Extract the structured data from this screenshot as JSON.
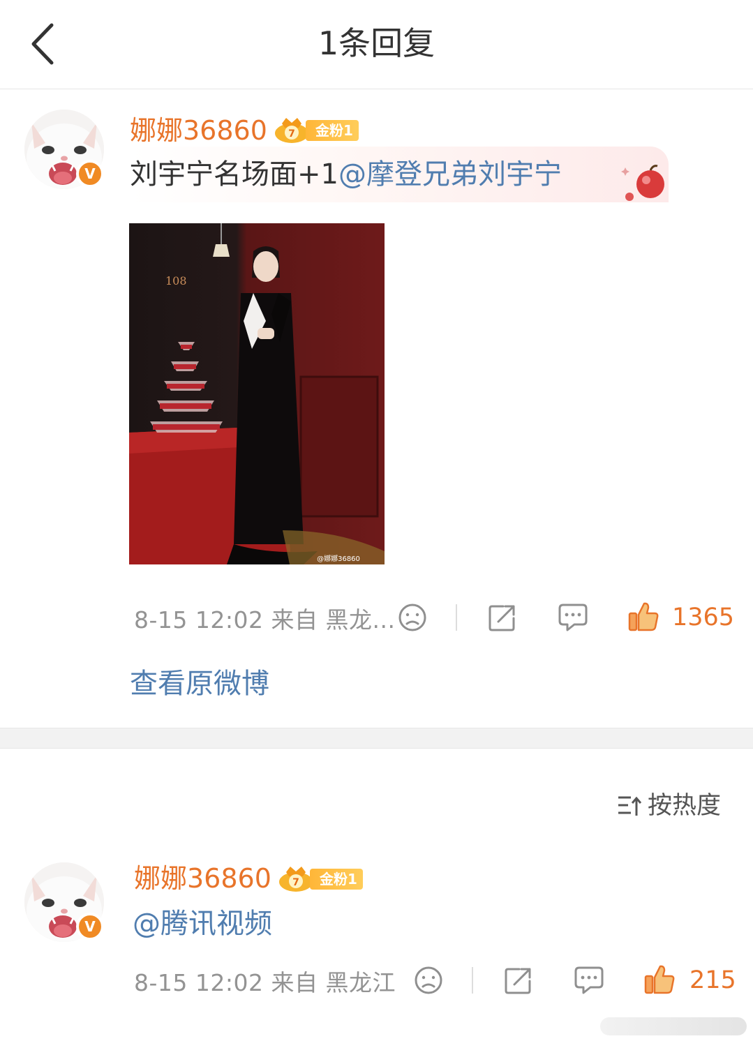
{
  "header": {
    "title": "1条回复"
  },
  "main_comment": {
    "username": "娜娜36860",
    "fan_badge": "金粉1",
    "text_prefix": "刘宇宁名场面+1",
    "mention": "@摩登兄弟刘宇宁",
    "photo_sign": "108",
    "photo_watermark": "@娜娜36860",
    "meta": "8-15 12:02  来自 黑龙...",
    "like_count": "1365",
    "view_original": "查看原微博"
  },
  "sort": {
    "label": "按热度"
  },
  "reply": {
    "username": "娜娜36860",
    "fan_badge": "金粉1",
    "mention": "@腾讯视频",
    "meta": "8-15 12:02  来自 黑龙江",
    "like_count": "215"
  },
  "icons": {
    "back": "chevron-left-icon",
    "dislike": "sad-face-icon",
    "share": "share-icon",
    "comment": "comment-icon",
    "like": "thumbs-up-icon",
    "sort": "sort-icon",
    "verified": "verified-v-icon",
    "crown": "crown-badge-icon"
  },
  "colors": {
    "username": "#e8742a",
    "mention": "#507daf",
    "meta": "#939393",
    "like": "#f07c2b",
    "badge": "#ffb638"
  }
}
